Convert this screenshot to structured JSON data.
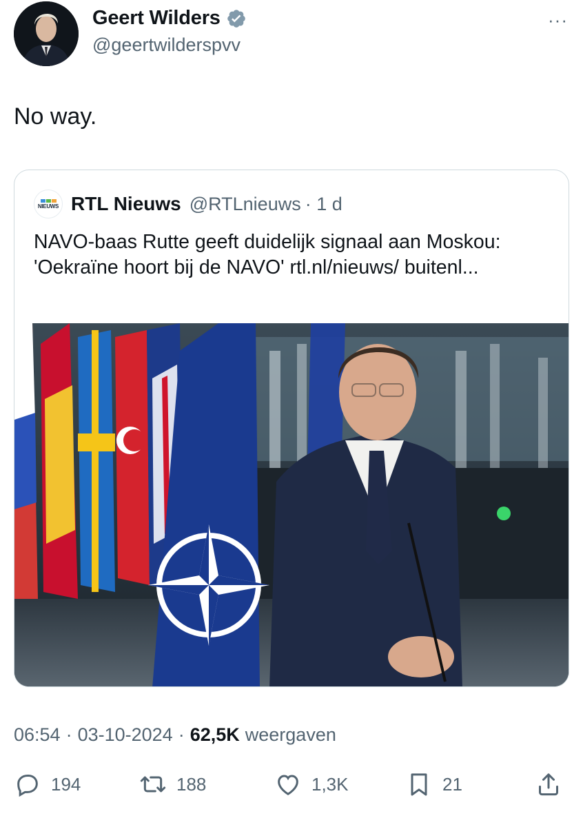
{
  "author": {
    "name": "Geert Wilders",
    "handle": "@geertwilderspvv",
    "verified": true
  },
  "more_label": "···",
  "tweet": {
    "text": "No way."
  },
  "quoted": {
    "avatar_label": "NIEUWS",
    "name": "RTL Nieuws",
    "handle": "@RTLnieuws",
    "time": "· 1 d",
    "text": "NAVO-baas Rutte geeft duidelijk signaal aan Moskou: 'Oekraïne hoort bij de NAVO' rtl.nl/nieuws/ buitenl..."
  },
  "meta": {
    "time": "06:54",
    "sep1": "·",
    "date": "03-10-2024",
    "sep2": "·",
    "views_count": "62,5K",
    "views_label": "weergaven"
  },
  "actions": {
    "replies": "194",
    "reposts": "188",
    "likes": "1,3K",
    "bookmarks": "21"
  },
  "colors": {
    "text": "#0f1419",
    "secondary": "#536471",
    "verified": "#829aab",
    "border": "#cfd9de",
    "nato_blue": "#1a3a8f"
  }
}
